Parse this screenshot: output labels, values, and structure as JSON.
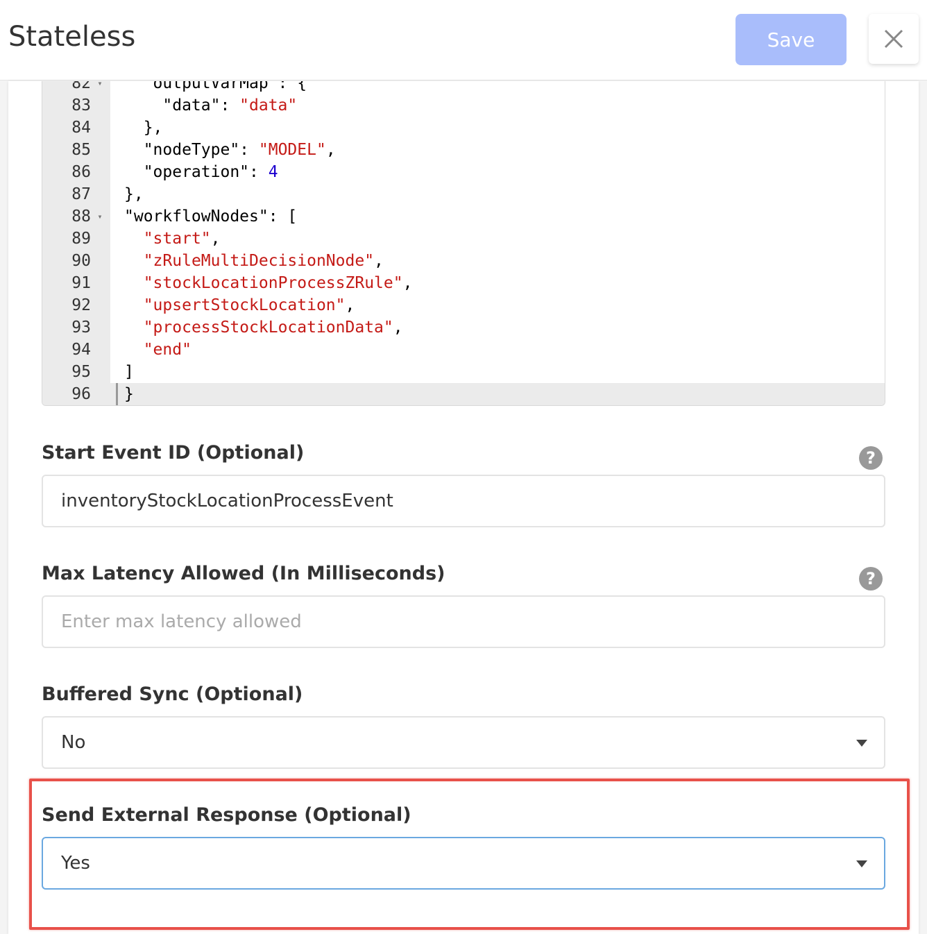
{
  "header": {
    "title": "Stateless",
    "save_label": "Save",
    "close_icon": "close-icon"
  },
  "editor": {
    "lines": [
      {
        "n": "82",
        "fold": true,
        "text": "  \"outputVarMap\": {"
      },
      {
        "n": "83",
        "fold": false,
        "text": "    \"data\": \"data\""
      },
      {
        "n": "84",
        "fold": false,
        "text": "  },"
      },
      {
        "n": "85",
        "fold": false,
        "text": "  \"nodeType\": \"MODEL\","
      },
      {
        "n": "86",
        "fold": false,
        "text": "  \"operation\": 4"
      },
      {
        "n": "87",
        "fold": false,
        "text": "},"
      },
      {
        "n": "88",
        "fold": true,
        "text": "\"workflowNodes\": ["
      },
      {
        "n": "89",
        "fold": false,
        "text": "  \"start\","
      },
      {
        "n": "90",
        "fold": false,
        "text": "  \"zRuleMultiDecisionNode\","
      },
      {
        "n": "91",
        "fold": false,
        "text": "  \"stockLocationProcessZRule\","
      },
      {
        "n": "92",
        "fold": false,
        "text": "  \"upsertStockLocation\","
      },
      {
        "n": "93",
        "fold": false,
        "text": "  \"processStockLocationData\","
      },
      {
        "n": "94",
        "fold": false,
        "text": "  \"end\""
      },
      {
        "n": "95",
        "fold": false,
        "text": "]"
      },
      {
        "n": "96",
        "fold": false,
        "text": "}"
      }
    ]
  },
  "form": {
    "start_event": {
      "label": "Start Event ID (Optional)",
      "value": "inventoryStockLocationProcessEvent",
      "help_icon": "?"
    },
    "max_latency": {
      "label": "Max Latency Allowed (In Milliseconds)",
      "placeholder": "Enter max latency allowed",
      "help_icon": "?"
    },
    "buffered_sync": {
      "label": "Buffered Sync (Optional)",
      "value": "No"
    },
    "send_external_response": {
      "label": "Send External Response (Optional)",
      "value": "Yes"
    }
  },
  "colors": {
    "save_button": "#a9bdfb",
    "highlight": "#e8514a",
    "string": "#c41a16",
    "number": "#1c00cf"
  }
}
